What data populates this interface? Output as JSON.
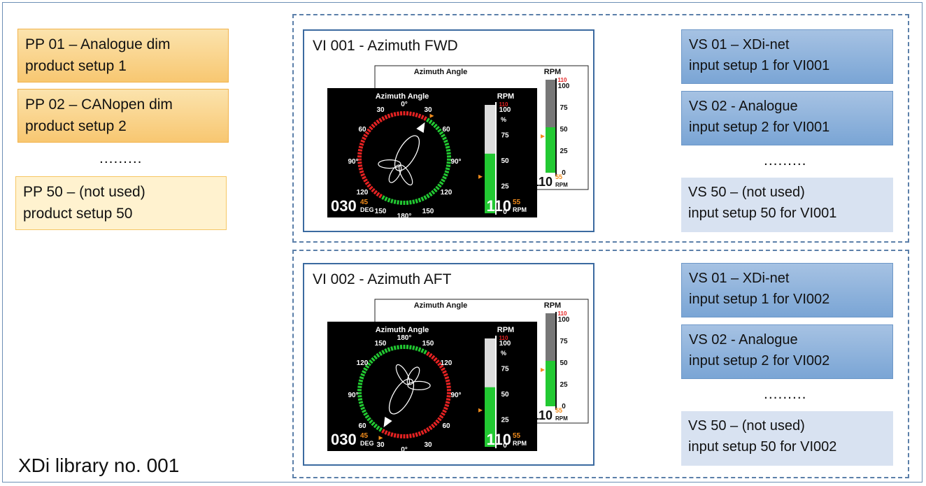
{
  "library_title": "XDi library no. 001",
  "products": [
    {
      "line1": "PP 01 – Analogue dim",
      "line2": "product setup 1"
    },
    {
      "line1": "PP 02 – CANopen dim",
      "line2": "product setup 2"
    },
    {
      "line1": "PP 50 – (not used)",
      "line2": "product setup 50"
    }
  ],
  "ellipsis": ".........",
  "virtual_instruments": [
    {
      "title": "VI 001 - Azimuth FWD",
      "setups": [
        {
          "line1": "VS 01 – XDi-net",
          "line2": "input setup 1 for VI001"
        },
        {
          "line1": "VS 02 - Analogue",
          "line2": "input setup 2 for VI001"
        },
        {
          "line1": "VS 50 – (not used)",
          "line2": "input setup 50 for VI001"
        }
      ]
    },
    {
      "title": "VI 002 - Azimuth AFT",
      "setups": [
        {
          "line1": "VS 01 – XDi-net",
          "line2": "input setup 1 for VI002"
        },
        {
          "line1": "VS 02 - Analogue",
          "line2": "input setup 2 for VI002"
        },
        {
          "line1": "VS 50 – (not used)",
          "line2": "input setup 50 for VI002"
        }
      ]
    }
  ],
  "display": {
    "azimuth_label": "Azimuth Angle",
    "rpm_label": "RPM",
    "rpm_max_red": "110",
    "rpm_scale": [
      "100",
      "75",
      "50",
      "25",
      "0"
    ],
    "rpm_unit": "%",
    "deg_value": "030",
    "deg_sub": "45",
    "deg_unit": "DEG",
    "rpm_value": "110",
    "rpm_sub": "55",
    "rpm_unit_txt": "RPM",
    "fwd_labels": [
      "0°",
      "30",
      "30",
      "60",
      "60",
      "90°",
      "90°",
      "120",
      "120",
      "150",
      "150",
      "180°"
    ],
    "aft_labels": [
      "180°",
      "150",
      "150",
      "120",
      "120",
      "90°",
      "90°",
      "60",
      "60",
      "30",
      "30",
      "0°"
    ],
    "fwd_angle_deg": 30,
    "aft_angle_deg": 210,
    "rpm_fill_percent": 55
  },
  "colors": {
    "product_dark": "#f8c771",
    "product_light": "#fff2cf",
    "setup_dark": "#7aa5d5",
    "setup_light": "#d8e2f1",
    "dashed_border": "#5b7fa9",
    "gauge_green": "#22c932",
    "gauge_red": "#e52222",
    "accent_orange": "#f28c1c"
  }
}
